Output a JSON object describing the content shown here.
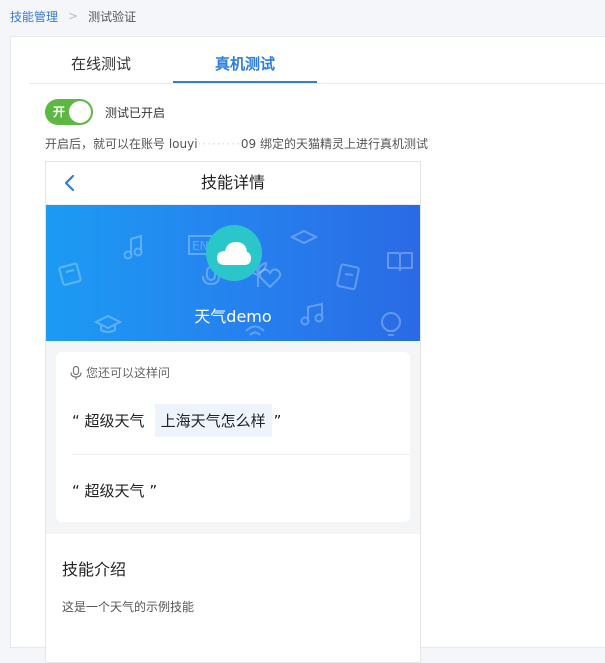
{
  "breadcrumb": {
    "parent": "技能管理",
    "current": "测试验证"
  },
  "tabs": [
    {
      "label": "在线测试",
      "active": false
    },
    {
      "label": "真机测试",
      "active": true
    }
  ],
  "switch": {
    "state_text": "开",
    "label": "测试已开启",
    "on": true
  },
  "hint": {
    "prefix": "开启后，就可以在账号 louyi",
    "masked": "·········",
    "suffix": "09 绑定的天猫精灵上进行真机测试"
  },
  "phone": {
    "title": "技能详情",
    "skill_name": "天气demo",
    "ask_header": "您还可以这样问",
    "examples": [
      {
        "trigger": "超级天气",
        "query": "上海天气怎么样"
      },
      {
        "trigger": "超级天气",
        "query": ""
      }
    ],
    "intro_title": "技能介绍",
    "intro_desc": "这是一个天气的示例技能"
  },
  "colors": {
    "accent": "#2d7ee0",
    "switch_on": "#5db843",
    "banner_start": "#1c9bf3",
    "banner_end": "#2a6ae4",
    "cloud_badge": "#2bc6c9"
  }
}
